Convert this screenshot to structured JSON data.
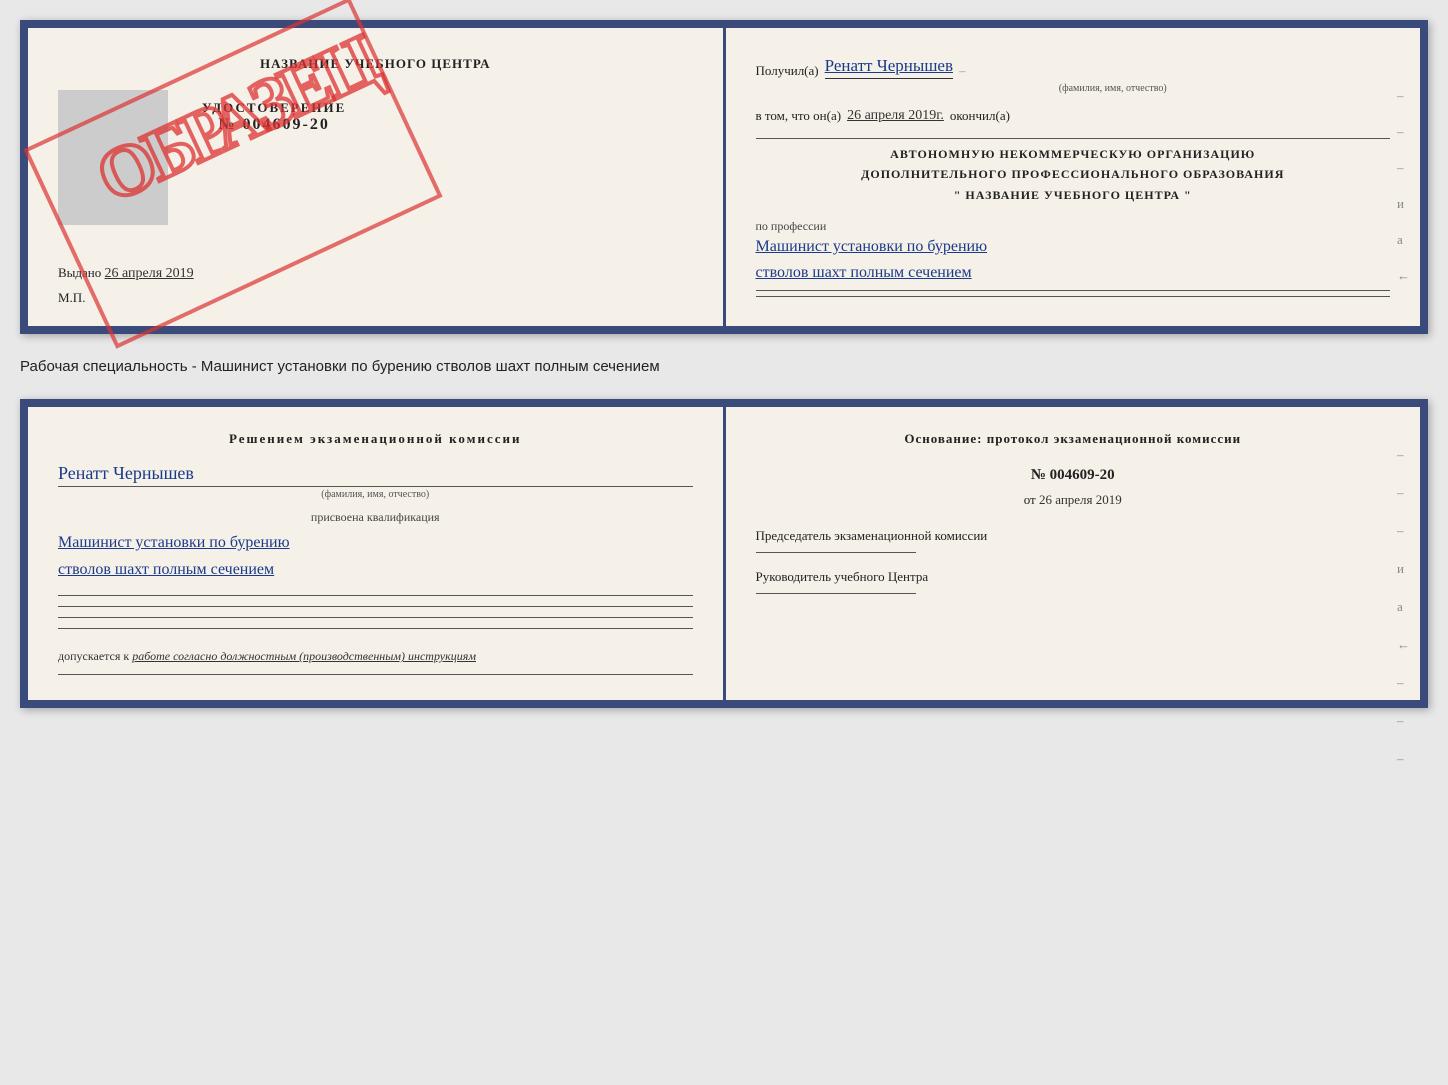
{
  "cert_top": {
    "left": {
      "title": "НАЗВАНИЕ УЧЕБНОГО ЦЕНТРА",
      "udostoverenie_label": "УДОСТОВЕРЕНИЕ",
      "udostoverenie_num": "№ 004609-20",
      "vydano_prefix": "Выдано",
      "vydano_date": "26 апреля 2019",
      "mp_label": "М.П.",
      "obrazec_text": "ОБРАЗЕЦ"
    },
    "right": {
      "poluchil_prefix": "Получил(а)",
      "poluchil_name": "Ренатт Чернышев",
      "fio_hint": "(фамилия, имя, отчество)",
      "dash1": "–",
      "vtom_prefix": "в том, что он(а)",
      "vtom_date": "26 апреля 2019г.",
      "okonchil": "окончил(а)",
      "dash2": "–",
      "org_line1": "АВТОНОМНУЮ НЕКОММЕРЧЕСКУЮ ОРГАНИЗАЦИЮ",
      "org_line2": "ДОПОЛНИТЕЛЬНОГО ПРОФЕССИОНАЛЬНОГО ОБРАЗОВАНИЯ",
      "org_line3": "\"  НАЗВАНИЕ УЧЕБНОГО ЦЕНТРА  \"",
      "po_professii": "по профессии",
      "profession1": "Машинист установки по бурению",
      "profession2": "стволов шахт полным сечением"
    }
  },
  "specialty_label": "Рабочая специальность - Машинист установки по бурению стволов шахт полным сечением",
  "cert_bottom": {
    "left": {
      "reshenie_title": "Решением  экзаменационной  комиссии",
      "name": "Ренатт Чернышев",
      "fio_hint": "(фамилия, имя, отчество)",
      "prisvoena_label": "присвоена квалификация",
      "qualification1": "Машинист установки по бурению",
      "qualification2": "стволов шахт полным сечением",
      "dopuskaetsya_prefix": "допускается к",
      "dopuskaetsya_italic": "работе согласно должностным (производственным) инструкциям"
    },
    "right": {
      "osnov_title": "Основание: протокол экзаменационной  комиссии",
      "protocol_num": "№  004609-20",
      "protocol_date_prefix": "от",
      "protocol_date": "26 апреля 2019",
      "predsedatel_label": "Председатель экзаменационной комиссии",
      "rukovoditel_label": "Руководитель учебного Центра"
    }
  },
  "side_chars": {
    "top": [
      "–",
      "–",
      "–",
      "и",
      "а",
      "←"
    ],
    "bottom": [
      "–",
      "–",
      "–",
      "и",
      "а",
      "←",
      "–",
      "–",
      "–"
    ]
  }
}
